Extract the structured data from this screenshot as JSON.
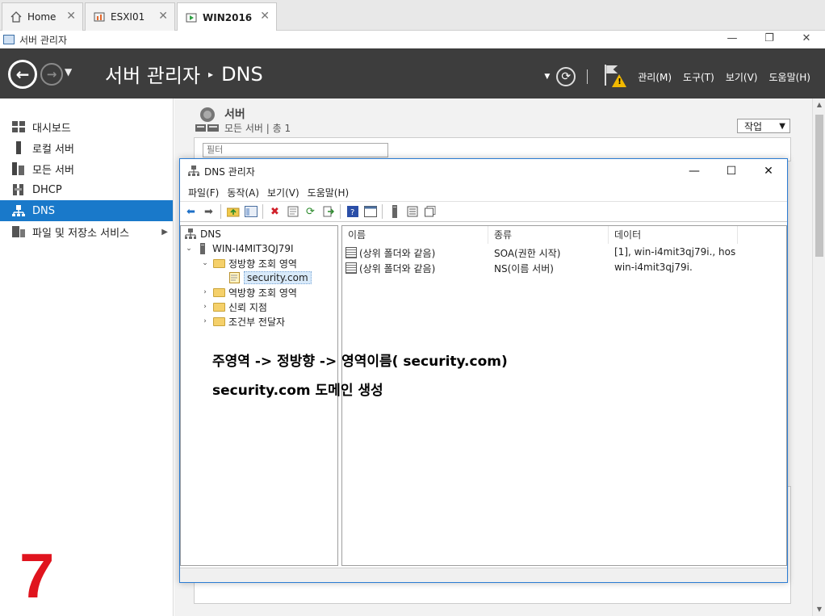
{
  "browser_tabs": [
    {
      "label": "Home"
    },
    {
      "label": "ESXI01"
    },
    {
      "label": "WIN2016"
    }
  ],
  "window": {
    "title": "서버 관리자",
    "controls": {
      "minimize": "—",
      "restore": "❐",
      "close": "✕"
    }
  },
  "header": {
    "crumb_root": "서버 관리자",
    "crumb_leaf": "DNS",
    "menus": [
      "관리(M)",
      "도구(T)",
      "보기(V)",
      "도움말(H)"
    ]
  },
  "sidebar": {
    "items": [
      {
        "label": "대시보드",
        "icon": "dashboard-icon"
      },
      {
        "label": "로컬 서버",
        "icon": "local-server-icon"
      },
      {
        "label": "모든 서버",
        "icon": "all-servers-icon"
      },
      {
        "label": "DHCP",
        "icon": "dhcp-icon"
      },
      {
        "label": "DNS",
        "icon": "dns-icon",
        "active": true
      },
      {
        "label": "파일 및 저장소 서비스",
        "icon": "file-storage-icon",
        "has_children": true
      }
    ]
  },
  "main": {
    "section_title": "서버",
    "section_sub": "모든 서버 | 총 1",
    "task_button": "작업",
    "filter_placeholder": "필터"
  },
  "dns_manager": {
    "title": "DNS 관리자",
    "controls": {
      "minimize": "—",
      "maximize": "☐",
      "close": "✕"
    },
    "menu": [
      "파일(F)",
      "동작(A)",
      "보기(V)",
      "도움말(H)"
    ],
    "tree": {
      "root": "DNS",
      "server": "WIN-I4MIT3QJ79I",
      "forward_zones": "정방향 조회 영역",
      "zone": "security.com",
      "reverse_zones": "역방향 조회 영역",
      "trust_points": "신뢰 지점",
      "conditional_forwarders": "조건부 전달자"
    },
    "columns": [
      "이름",
      "종류",
      "데이터"
    ],
    "records": [
      {
        "name": "(상위 폴더와 같음)",
        "type": "SOA(권한 시작)",
        "data": "[1], win-i4mit3qj79i., hos..."
      },
      {
        "name": "(상위 폴더와 같음)",
        "type": "NS(이름 서버)",
        "data": "win-i4mit3qj79i."
      }
    ]
  },
  "annotation": {
    "line1": "주영역 -> 정방향 -> 영역이름( security.com)",
    "line2": "security.com 도메인 생성",
    "step_number": "7"
  },
  "colors": {
    "header_bg": "#3d3d3d",
    "sidebar_active": "#1979ca",
    "step_number": "#e0141e",
    "warning": "#f2b900"
  }
}
